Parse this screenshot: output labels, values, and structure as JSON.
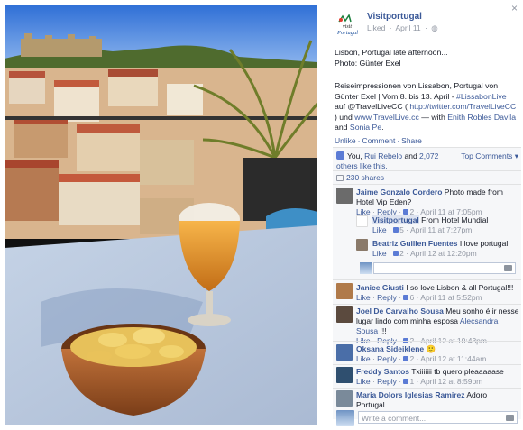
{
  "colors": {
    "link": "#3b5998",
    "muted": "#9197a3",
    "panel_bg": "#f6f7f9"
  },
  "photo": {
    "alt": "Beer glass and bowl of chips on a Lisbon rooftop terrace with castle view"
  },
  "header": {
    "page_name": "Visitportugal",
    "logo_text": "visit Portugal",
    "status": "Liked",
    "date": "April 11",
    "close": "×"
  },
  "post": {
    "line1": "Lisbon, Portugal late afternoon...",
    "line2": "Photo: Günter Exel",
    "p2_a": "Reiseimpressionen von Lissabon, Portugal von Günter Exel | Vom 8. bis 13. April - ",
    "hashtag": "#LissabonLive",
    "p2_b": " auf @TravelLiveCC ( ",
    "url1": "http://twitter.com/TravelLiveCC",
    "p2_c": " ) und ",
    "url2": "www.TravelLive.cc",
    "p2_d": " — with ",
    "tag1": "Enith Robles Davila",
    "p2_e": " and ",
    "tag2": "Sonia Pe",
    "p2_f": "."
  },
  "actions": {
    "unlike": "Unlike",
    "comment": "Comment",
    "share": "Share"
  },
  "likes": {
    "you": "You, ",
    "name": "Rui Rebelo",
    "and": " and ",
    "count": "2,072",
    "rest": " others like this.",
    "top_comments": "Top Comments ▾"
  },
  "shares": "230 shares",
  "comments": [
    {
      "author": "Jaime Gonzalo Cordero",
      "text": " Photo made from Hotel Vip Eden?",
      "likes": "2",
      "time": "April 11 at 7:05pm"
    },
    {
      "author": "Visitportugal",
      "text": " From Hotel Mundial",
      "likes": "5",
      "time": "April 11 at 7:27pm"
    },
    {
      "author": "Beatriz Guillen Fuentes",
      "text": " I love portugal",
      "likes": "2",
      "time": "April 12 at 12:20pm"
    },
    {
      "author": "Janice Giusti",
      "text": " I so love Lisbon & all Portugal!!!",
      "likes": "6",
      "time": "April 11 at 5:52pm"
    },
    {
      "author": "Joel De Carvalho Sousa",
      "text": " Meu sonho é ir nesse lugar lindo com minha esposa ",
      "tag": "Alecsandra Sousa",
      "text2": " !!!",
      "likes": "2",
      "time": "April 12 at 10:43pm"
    },
    {
      "author": "Oksana Sideiklene",
      "text": " 🙂",
      "likes": "2",
      "time": "April 12 at 11:44am"
    },
    {
      "author": "Freddy Santos",
      "text": " Txiiiiiii tb quero pleaaaaase",
      "likes": "1",
      "time": "April 12 at 8:59pm"
    },
    {
      "author": "Maria Dolors Iglesias Ramirez",
      "text": " Adoro Portugal..."
    }
  ],
  "meta": {
    "like": "Like",
    "reply": "Reply"
  },
  "write_comment_placeholder": "Write a comment..."
}
